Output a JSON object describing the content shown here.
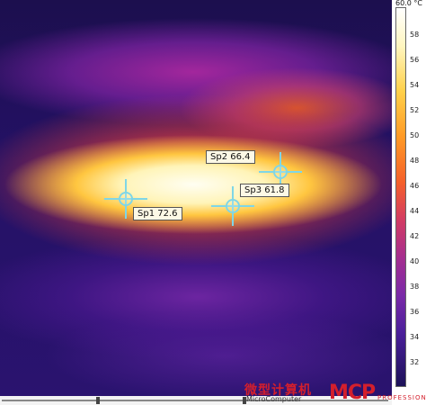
{
  "spots": [
    {
      "label": "Sp1 72.6"
    },
    {
      "label": "Sp2 66.4"
    },
    {
      "label": "Sp3 61.8"
    }
  ],
  "scale": {
    "max_label": "60.0 °C",
    "ticks": [
      "58",
      "56",
      "54",
      "52",
      "50",
      "48",
      "46",
      "44",
      "42",
      "40",
      "38",
      "36",
      "34",
      "32"
    ]
  },
  "watermark": {
    "cn": "微型计算机",
    "en": "MicroComputer",
    "logo": "MCP",
    "logo_sub": "PROFESSIONAL"
  }
}
